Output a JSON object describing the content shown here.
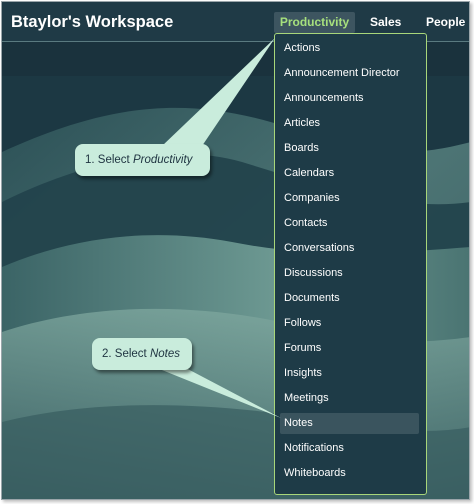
{
  "workspace_title": "Btaylor's Workspace",
  "nav": {
    "productivity": "Productivity",
    "sales": "Sales",
    "people": "People"
  },
  "menu": {
    "items": [
      "Actions",
      "Announcement Director",
      "Announcements",
      "Articles",
      "Boards",
      "Calendars",
      "Companies",
      "Contacts",
      "Conversations",
      "Discussions",
      "Documents",
      "Follows",
      "Forums",
      "Insights",
      "Meetings",
      "Notes",
      "Notifications",
      "Whiteboards"
    ],
    "selected": "Notes"
  },
  "callouts": {
    "step1_prefix": "1. Select ",
    "step1_target": "Productivity",
    "step2_prefix": "2. Select ",
    "step2_target": "Notes"
  },
  "colors": {
    "accent_green": "#a6e07d",
    "callout_fill": "#c9ecdc",
    "header_bg": "#1f3a46"
  }
}
